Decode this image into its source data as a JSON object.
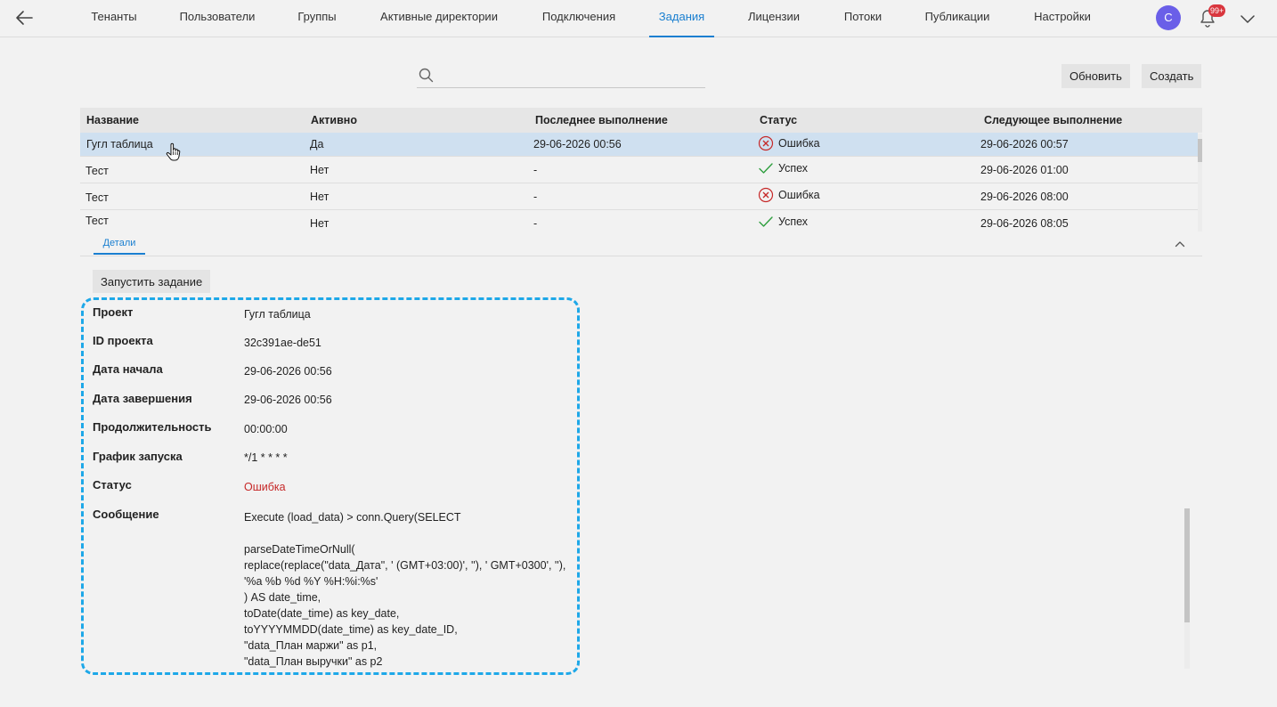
{
  "nav": {
    "items": [
      "Тенанты",
      "Пользователи",
      "Группы",
      "Активные директории",
      "Подключения",
      "Задания",
      "Лицензии",
      "Потоки",
      "Публикации",
      "Настройки"
    ],
    "active": "Задания",
    "avatar_letter": "С",
    "notifications_badge": "99+",
    "icons": [
      "arrow-left-icon",
      "bell-icon",
      "chevron-down-icon"
    ]
  },
  "toolbar": {
    "search_placeholder": "",
    "refresh_label": "Обновить",
    "create_label": "Создать"
  },
  "table": {
    "headers": [
      "Название",
      "Активно",
      "Последнее выполнение",
      "Статус",
      "Следующее выполнение"
    ],
    "rows": [
      {
        "name": "Гугл таблица",
        "active": "Да",
        "last_run": "29-06-2026 00:56",
        "status": "Ошибка",
        "status_kind": "error",
        "next_run": "29-06-2026 00:57",
        "selected": true
      },
      {
        "name": "Тест",
        "active": "Нет",
        "last_run": "-",
        "status": "Успех",
        "status_kind": "success",
        "next_run": "29-06-2026 01:00"
      },
      {
        "name": "Тест",
        "active": "Нет",
        "last_run": "-",
        "status": "Ошибка",
        "status_kind": "error",
        "next_run": "29-06-2026 08:00"
      },
      {
        "name": "Тест",
        "active": "Нет",
        "last_run": "-",
        "status": "Успех",
        "status_kind": "success",
        "next_run": "29-06-2026 08:05"
      }
    ]
  },
  "details": {
    "tab_label": "Детали",
    "run_button": "Запустить задание",
    "fields": [
      {
        "label": "Проект",
        "value": "Гугл таблица"
      },
      {
        "label": "ID проекта",
        "value": "32c391ae-de51"
      },
      {
        "label": "Дата начала",
        "value": "29-06-2026 00:56"
      },
      {
        "label": "Дата завершения",
        "value": "29-06-2026 00:56"
      },
      {
        "label": "Продолжительность",
        "value": "00:00:00"
      },
      {
        "label": "График запуска",
        "value": "*/1 * * * *"
      },
      {
        "label": "Статус",
        "value": "Ошибка"
      },
      {
        "label": "Сообщение",
        "value": ""
      }
    ],
    "message": "Execute (load_data) > conn.Query(SELECT\n\nparseDateTimeOrNull(\nreplace(replace(\"data_Дата\", ' (GMT+03:00)', ''), ' GMT+0300', ''),\n'%a %b %d %Y %H:%i:%s'\n) AS date_time,\ntoDate(date_time) as key_date,\ntoYYYYMMDD(date_time) as key_date_ID,\n\"data_План маржи\" as p1,\n\"data_План выручки\" as p2"
  },
  "colors": {
    "accent": "#1a7fd0",
    "error": "#c62828",
    "success": "#2e9e3e",
    "highlight_border": "#1ea8e8",
    "selected_row": "#cfe0f0",
    "avatar": "#6a5fe8"
  }
}
